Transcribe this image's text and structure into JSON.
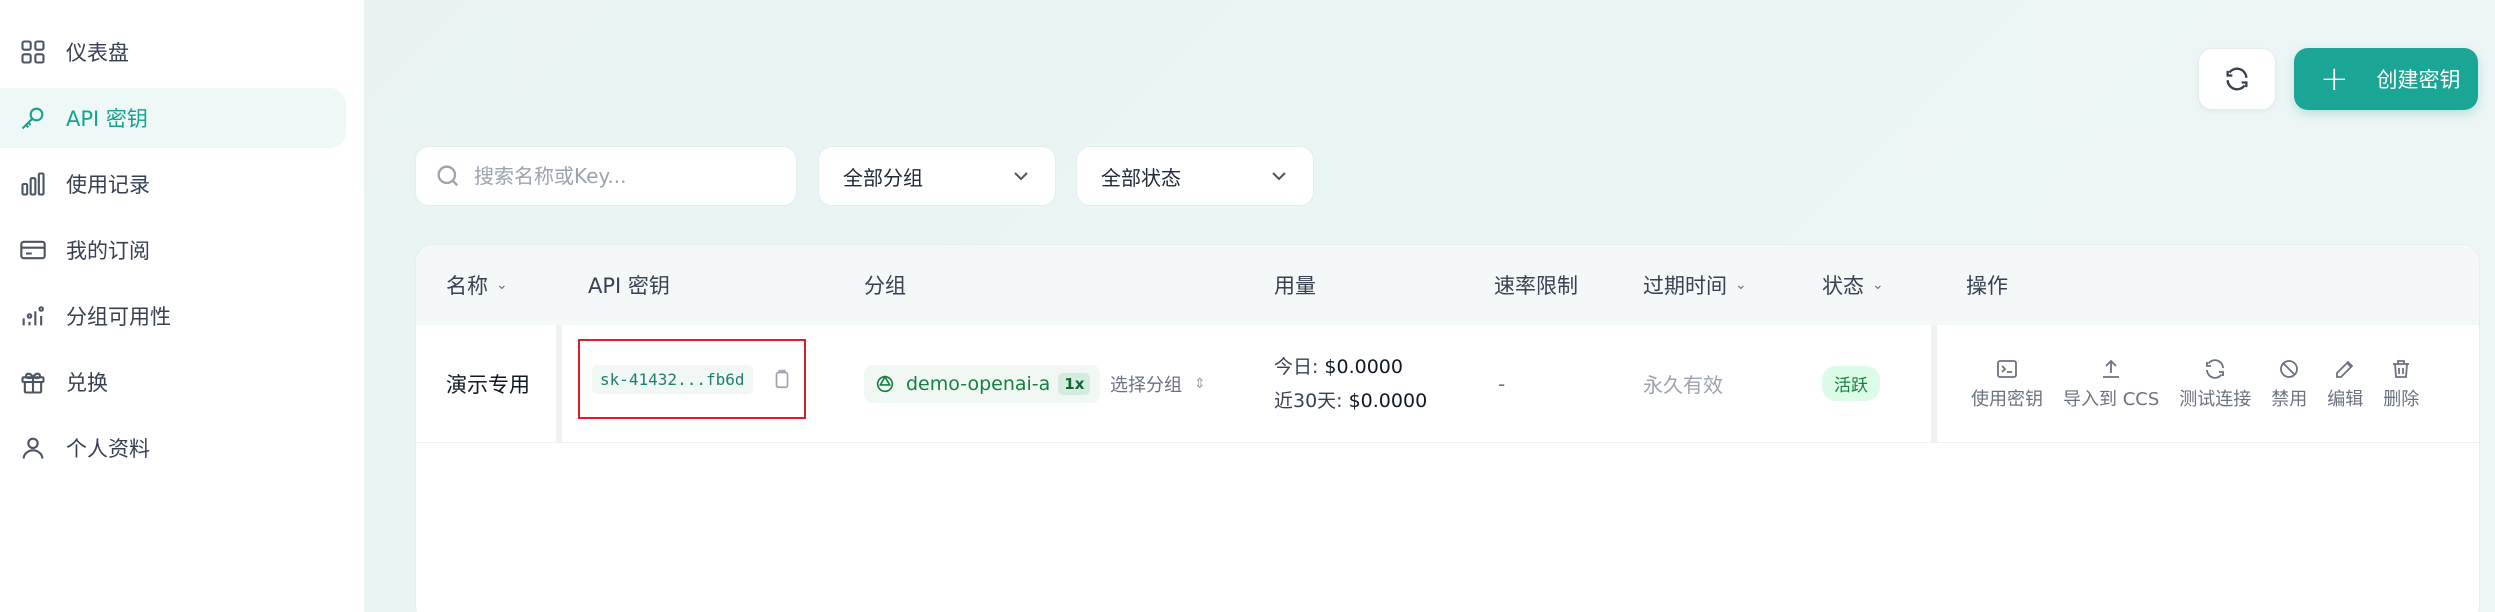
{
  "sidebar": {
    "items": [
      {
        "label": "仪表盘",
        "icon": "dashboard-icon"
      },
      {
        "label": "API 密钥",
        "icon": "key-icon",
        "active": true
      },
      {
        "label": "使用记录",
        "icon": "bar-chart-icon"
      },
      {
        "label": "我的订阅",
        "icon": "credit-card-icon"
      },
      {
        "label": "分组可用性",
        "icon": "signal-icon"
      },
      {
        "label": "兑换",
        "icon": "gift-icon"
      },
      {
        "label": "个人资料",
        "icon": "user-icon"
      }
    ]
  },
  "toolbar": {
    "create_label": "创建密钥"
  },
  "filters": {
    "search_placeholder": "搜索名称或Key...",
    "group_select": "全部分组",
    "status_select": "全部状态"
  },
  "table": {
    "headers": {
      "name": "名称",
      "key": "API 密钥",
      "group": "分组",
      "usage": "用量",
      "rate": "速率限制",
      "expire": "过期时间",
      "status": "状态",
      "actions": "操作"
    },
    "rows": [
      {
        "name": "演示专用",
        "key": "sk-41432...fb6d",
        "group": "demo-openai-a",
        "multiplier": "1x",
        "select_group": "选择分组",
        "usage_today_label": "今日:",
        "usage_today": "$0.0000",
        "usage_30_label": "近30天:",
        "usage_30": "$0.0000",
        "rate": "-",
        "expire": "永久有效",
        "status": "活跃",
        "actions": [
          "使用密钥",
          "导入到 CCS",
          "测试连接",
          "禁用",
          "编辑",
          "删除"
        ]
      }
    ]
  },
  "colors": {
    "accent": "#1aa594",
    "highlight_box": "#e11d2a"
  }
}
